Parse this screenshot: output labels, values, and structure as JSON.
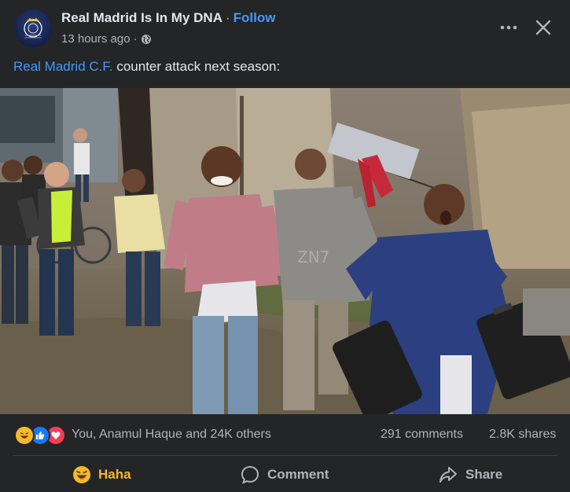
{
  "header": {
    "page_name": "Real Madrid Is In My DNA",
    "separator": "·",
    "follow_label": "Follow",
    "timestamp": "13 hours ago",
    "meta_separator": "·",
    "privacy_icon": "globe-icon",
    "more_icon": "more-horizontal-icon",
    "close_icon": "close-icon"
  },
  "caption": {
    "mention": "Real Madrid C.F.",
    "text": " counter attack next season:"
  },
  "image": {
    "watermark": "ZN7"
  },
  "reactions": {
    "icons": [
      "haha-icon",
      "like-icon",
      "love-icon"
    ],
    "summary": "You, Anamul Haque and 24K others",
    "comments": "291 comments",
    "shares": "2.8K shares"
  },
  "actions": {
    "haha_label": "Haha",
    "comment_label": "Comment",
    "share_label": "Share"
  },
  "colors": {
    "background": "#242526",
    "link": "#4599ff",
    "haha": "#f7b928",
    "like": "#1877f2",
    "love": "#f33e58",
    "muted": "#b0b3b8"
  }
}
